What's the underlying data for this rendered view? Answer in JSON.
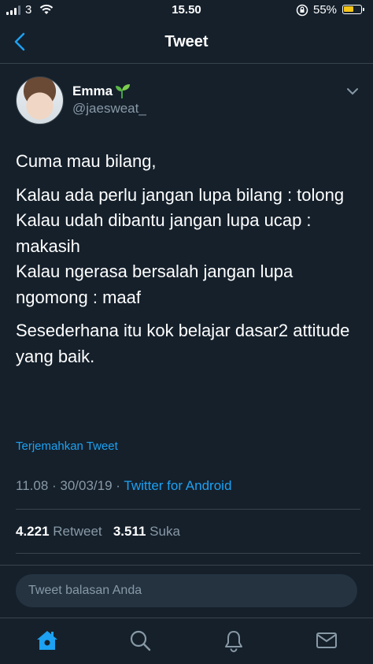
{
  "status": {
    "carrier": "3",
    "time": "15.50",
    "battery": "55%"
  },
  "nav": {
    "title": "Tweet"
  },
  "author": {
    "name": "Emma",
    "handle": "@jaesweat_"
  },
  "tweet": {
    "paragraphs": [
      "Cuma mau bilang,",
      "Kalau ada perlu jangan lupa bilang : tolong\nKalau udah dibantu jangan lupa ucap : makasih\nKalau ngerasa bersalah jangan lupa ngomong : maaf",
      "Sesederhana itu kok belajar dasar2 attitude yang baik."
    ],
    "translate_label": "Terjemahkan Tweet",
    "time": "11.08",
    "date": "30/03/19",
    "source": "Twitter for Android",
    "retweet_count": "4.221",
    "retweet_label": "Retweet",
    "like_count": "3.511",
    "like_label": "Suka"
  },
  "reply": {
    "placeholder": "Tweet balasan Anda"
  },
  "tabs": [
    "home-icon",
    "search-icon",
    "notifications-icon",
    "messages-icon"
  ],
  "colors": {
    "background": "#15202b",
    "accent": "#1da1f2",
    "muted": "#8899a6",
    "divider": "#38444d"
  }
}
